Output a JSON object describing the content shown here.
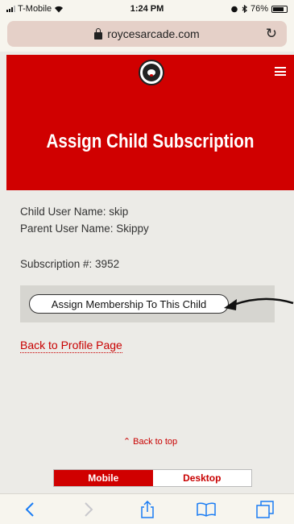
{
  "status_bar": {
    "carrier": "T-Mobile",
    "time": "1:24 PM",
    "battery": "76%"
  },
  "browser": {
    "url": "roycesarcade.com"
  },
  "header": {
    "title": "Assign Child Subscription"
  },
  "content": {
    "child_user": "Child User Name: skip",
    "parent_user": "Parent User Name: Skippy",
    "subscription": "Subscription #: 3952",
    "assign_button": "Assign Membership To This Child",
    "back_profile": "Back to Profile Page",
    "back_top": "Back to top"
  },
  "view_switch": {
    "mobile": "Mobile",
    "desktop": "Desktop"
  },
  "colors": {
    "brand_red": "#d00000",
    "link_red": "#c80000",
    "toolbar_blue": "#1a7cf4"
  },
  "icons": [
    "lock-icon",
    "reload-icon",
    "menu-icon",
    "back-arrow-icon",
    "forward-arrow-icon",
    "share-icon",
    "bookmarks-icon",
    "tabs-icon"
  ]
}
